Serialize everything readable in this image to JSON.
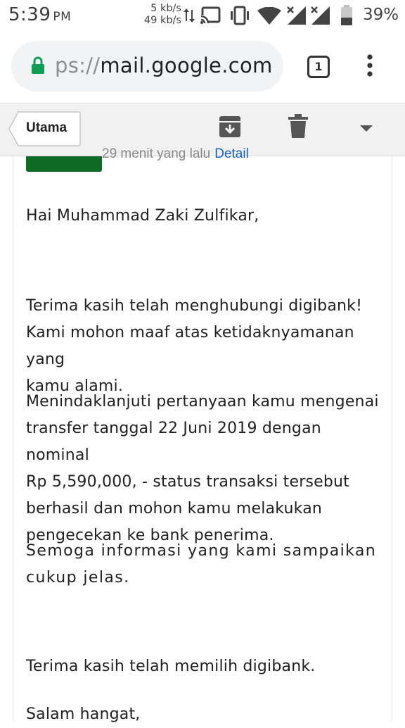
{
  "status_bar": {
    "time": "5:39",
    "ampm": "PM",
    "net_up": "5 kb/s",
    "net_down": "49 kb/s",
    "battery_percent": "39%",
    "icons": [
      "data-arrows-icon",
      "cast-icon",
      "vibrate-icon",
      "wifi-icon",
      "signal-icon",
      "signal-icon",
      "battery-icon"
    ]
  },
  "browser": {
    "url_scheme": "ps://",
    "url_host": "mail.google.com",
    "tab_count": "1"
  },
  "gmail_toolbar": {
    "back_label": "Utama",
    "icons": [
      "archive-icon",
      "trash-icon",
      "dropdown-icon"
    ]
  },
  "email": {
    "time_ago": "29 menit yang lalu",
    "detail_link": "Detail",
    "greeting": "Hai Muhammad Zaki Zulfikar,",
    "para1_line1": "Terima kasih telah menghubungi digibank!",
    "para1_line2": "Kami mohon maaf atas ketidaknyamanan yang",
    "para1_line3": "kamu alami.",
    "para2_line1": "Menindaklanjuti pertanyaan kamu mengenai",
    "para2_line2": "transfer tanggal 22 Juni 2019 dengan nominal",
    "para2_line3": "Rp 5,590,000, - status transaksi tersebut",
    "para2_line4": "berhasil dan mohon kamu melakukan",
    "para2_line5": "pengecekan ke bank penerima.",
    "para3_line1": "Semoga informasi yang kami sampaikan",
    "para3_line2": "cukup jelas.",
    "para4": "Terima kasih telah memilih digibank.",
    "closing": "Salam hangat,"
  },
  "colors": {
    "brand_green": "#0d6b26",
    "link_blue": "#1a5fd0",
    "lock_green": "#0f9d58",
    "toolbar_bg": "#f1f1f1"
  }
}
